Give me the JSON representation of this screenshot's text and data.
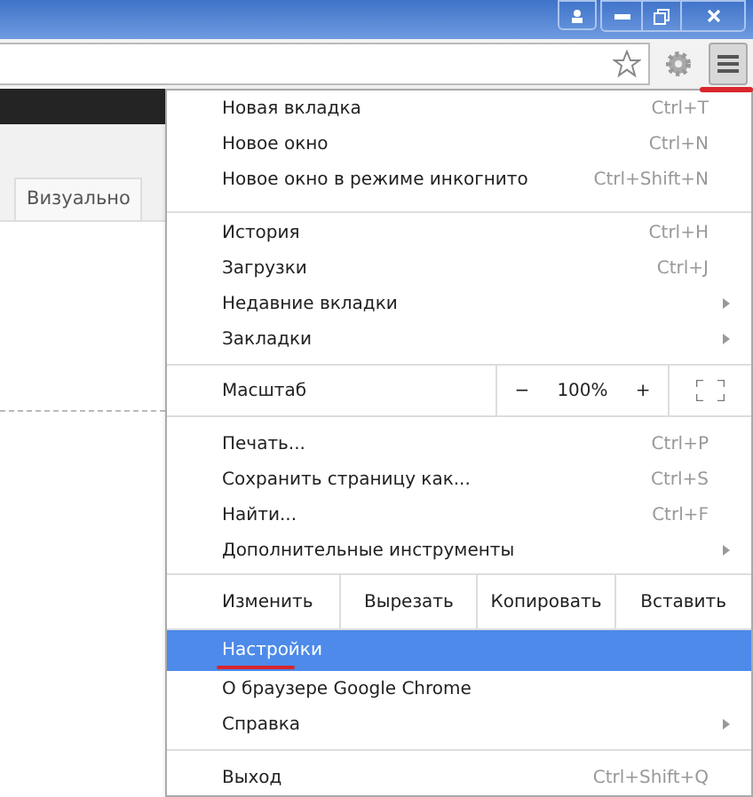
{
  "page": {
    "tab": {
      "label": "Визуально",
      "selected": true
    }
  },
  "menu": {
    "groups": [
      {
        "rows": [
          {
            "kind": "item",
            "label": "Новая вкладка",
            "shortcut": "Ctrl+T",
            "submenu": false,
            "selected": false
          },
          {
            "kind": "item",
            "label": "Новое окно",
            "shortcut": "Ctrl+N",
            "submenu": false,
            "selected": false
          },
          {
            "kind": "item",
            "label": "Новое окно в режиме инкогнито",
            "shortcut": "Ctrl+Shift+N",
            "submenu": false,
            "selected": false
          }
        ]
      },
      {
        "rows": [
          {
            "kind": "item",
            "label": "История",
            "shortcut": "Ctrl+H",
            "submenu": false,
            "selected": false
          },
          {
            "kind": "item",
            "label": "Загрузки",
            "shortcut": "Ctrl+J",
            "submenu": false,
            "selected": false
          },
          {
            "kind": "item",
            "label": "Недавние вкладки",
            "submenu": true,
            "selected": false
          },
          {
            "kind": "item",
            "label": "Закладки",
            "submenu": true,
            "selected": false
          }
        ]
      },
      {
        "rows": [
          {
            "kind": "zoom",
            "label": "Масштаб",
            "minus": "−",
            "value": "100%",
            "plus": "+"
          }
        ]
      },
      {
        "rows": [
          {
            "kind": "item",
            "label": "Печать...",
            "shortcut": "Ctrl+P",
            "submenu": false,
            "selected": false
          },
          {
            "kind": "item",
            "label": "Сохранить страницу как...",
            "shortcut": "Ctrl+S",
            "submenu": false,
            "selected": false
          },
          {
            "kind": "item",
            "label": "Найти...",
            "shortcut": "Ctrl+F",
            "submenu": false,
            "selected": false
          },
          {
            "kind": "item",
            "label": "Дополнительные инструменты",
            "submenu": true,
            "selected": false
          }
        ]
      },
      {
        "rows": [
          {
            "kind": "edit",
            "label": "Изменить",
            "buttons": [
              "Вырезать",
              "Копировать",
              "Вставить"
            ]
          }
        ]
      },
      {
        "rows": [
          {
            "kind": "item",
            "label": "Настройки",
            "submenu": false,
            "selected": true
          },
          {
            "kind": "item",
            "label": "О браузере Google Chrome",
            "submenu": false,
            "selected": false
          },
          {
            "kind": "item",
            "label": "Справка",
            "submenu": true,
            "selected": false
          }
        ]
      },
      {
        "rows": [
          {
            "kind": "item",
            "label": "Выход",
            "shortcut": "Ctrl+Shift+Q",
            "submenu": false,
            "selected": false
          }
        ]
      }
    ]
  }
}
